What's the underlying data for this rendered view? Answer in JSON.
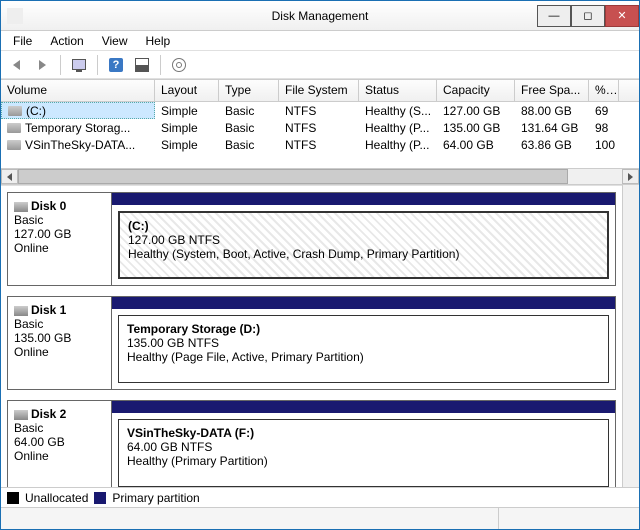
{
  "window": {
    "title": "Disk Management"
  },
  "menu": {
    "file": "File",
    "action": "Action",
    "view": "View",
    "help": "Help"
  },
  "columns": {
    "volume": "Volume",
    "layout": "Layout",
    "type": "Type",
    "filesystem": "File System",
    "status": "Status",
    "capacity": "Capacity",
    "freespace": "Free Spa...",
    "pctfree": "% F"
  },
  "volumes": [
    {
      "name": "(C:)",
      "layout": "Simple",
      "type": "Basic",
      "fs": "NTFS",
      "status": "Healthy (S...",
      "cap": "127.00 GB",
      "free": "88.00 GB",
      "pct": "69"
    },
    {
      "name": "Temporary Storag...",
      "layout": "Simple",
      "type": "Basic",
      "fs": "NTFS",
      "status": "Healthy (P...",
      "cap": "135.00 GB",
      "free": "131.64 GB",
      "pct": "98"
    },
    {
      "name": "VSinTheSky-DATA...",
      "layout": "Simple",
      "type": "Basic",
      "fs": "NTFS",
      "status": "Healthy (P...",
      "cap": "64.00 GB",
      "free": "63.86 GB",
      "pct": "100"
    }
  ],
  "disks": [
    {
      "name": "Disk 0",
      "type": "Basic",
      "size": "127.00 GB",
      "state": "Online",
      "part_title": "(C:)",
      "part_size": "127.00 GB NTFS",
      "part_status": "Healthy (System, Boot, Active, Crash Dump, Primary Partition)",
      "hatched": true
    },
    {
      "name": "Disk 1",
      "type": "Basic",
      "size": "135.00 GB",
      "state": "Online",
      "part_title": "Temporary Storage  (D:)",
      "part_size": "135.00 GB NTFS",
      "part_status": "Healthy (Page File, Active, Primary Partition)",
      "hatched": false
    },
    {
      "name": "Disk 2",
      "type": "Basic",
      "size": "64.00 GB",
      "state": "Online",
      "part_title": "VSinTheSky-DATA  (F:)",
      "part_size": "64.00 GB NTFS",
      "part_status": "Healthy (Primary Partition)",
      "hatched": false
    }
  ],
  "legend": {
    "unallocated": "Unallocated",
    "primary": "Primary partition"
  },
  "colwidths": {
    "volume": 154,
    "layout": 64,
    "type": 60,
    "fs": 80,
    "status": 78,
    "cap": 78,
    "free": 74,
    "pct": 30
  }
}
